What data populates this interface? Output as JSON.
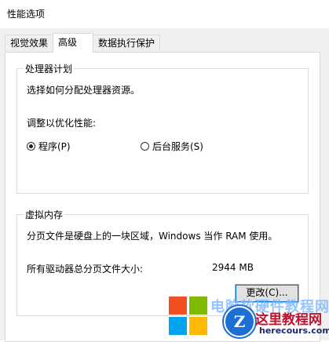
{
  "window": {
    "title": "性能选项"
  },
  "tabs": [
    {
      "label": "视觉效果"
    },
    {
      "label": "高级"
    },
    {
      "label": "数据执行保护"
    }
  ],
  "processor": {
    "group_title": "处理器计划",
    "description": "选择如何分配处理器资源。",
    "adjust_label": "调整以优化性能:",
    "options": [
      {
        "label": "程序(P)",
        "checked": true
      },
      {
        "label": "后台服务(S)",
        "checked": false
      }
    ]
  },
  "virtual_memory": {
    "group_title": "虚拟内存",
    "description": "分页文件是硬盘上的一块区域，Windows 当作 RAM 使用。",
    "total_label": "所有驱动器总分页文件大小:",
    "total_value": "2944 MB",
    "change_button": "更改(C)..."
  },
  "watermark": {
    "line1": "电脑软硬件教程网",
    "badge": "Z",
    "line2": "这里教程网",
    "line3": "herecours.com",
    "colors": {
      "red": "#f25022",
      "green": "#7fba00",
      "blue": "#00a4ef",
      "yellow": "#ffb900"
    }
  }
}
